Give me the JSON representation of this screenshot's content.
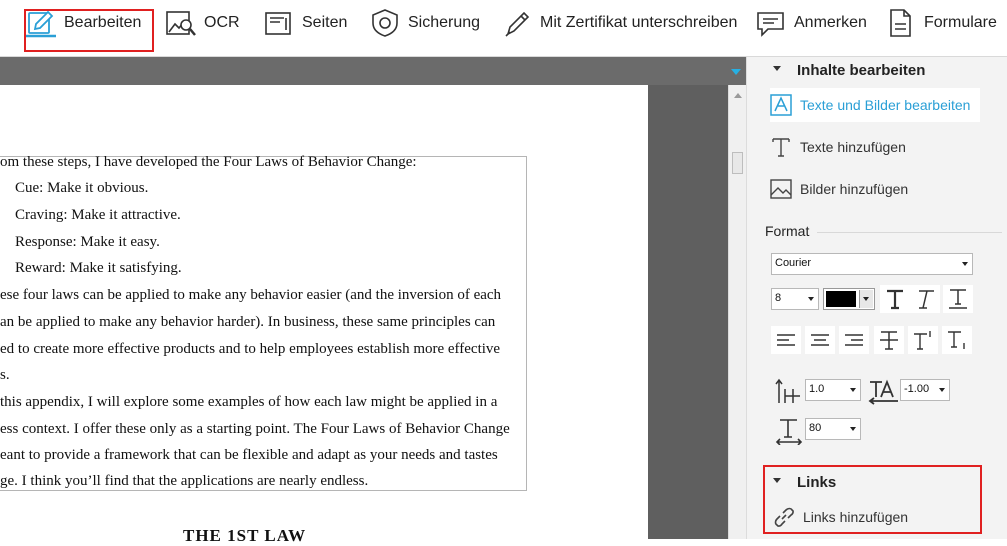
{
  "toolbar": {
    "items": [
      {
        "label": "Bearbeiten",
        "icon": "edit-pen-icon"
      },
      {
        "label": "OCR",
        "icon": "ocr-scan-icon"
      },
      {
        "label": "Seiten",
        "icon": "pages-icon"
      },
      {
        "label": "Sicherung",
        "icon": "shield-icon"
      },
      {
        "label": "Mit Zertifikat unterschreiben",
        "icon": "certificate-pen-icon"
      },
      {
        "label": "Anmerken",
        "icon": "comment-icon"
      },
      {
        "label": "Formulare",
        "icon": "form-icon"
      }
    ]
  },
  "document": {
    "lines": [
      "om these steps, I have developed the Four Laws of Behavior Change:",
      "Cue: Make it obvious.",
      "Craving: Make it attractive.",
      "Response: Make it easy.",
      "Reward: Make it satisfying.",
      "ese four laws can be applied to make any behavior easier (and the inversion of each",
      "an be applied to make any behavior harder). In business, these same principles can",
      "ed to create more effective products and to help employees establish more effective",
      "s.",
      " this appendix, I will explore some examples of how each law might be applied in a",
      "ess context. I offer these only as a starting point. The Four Laws of Behavior Change",
      "eant to provide a framework that can be flexible and adapt as your needs and tastes",
      "ge. I think you’ll find that the applications are nearly endless."
    ],
    "heading_fragment": "THE 1ST LAW"
  },
  "sidebar": {
    "content_section": {
      "title": "Inhalte bearbeiten",
      "items": [
        {
          "label": "Texte und Bilder bearbeiten",
          "icon": "text-image-edit-icon",
          "active": true
        },
        {
          "label": "Texte hinzufügen",
          "icon": "text-add-icon",
          "active": false
        },
        {
          "label": "Bilder hinzufügen",
          "icon": "image-add-icon",
          "active": false
        }
      ]
    },
    "format": {
      "label": "Format",
      "font": "Courier",
      "size": "8",
      "color": "#000000",
      "line_spacing": "1.0",
      "char_spacing": "-1.00",
      "scale": "80"
    },
    "links_section": {
      "title": "Links",
      "item": {
        "label": "Links hinzufügen",
        "icon": "link-icon"
      }
    }
  },
  "colors": {
    "accent": "#2a9fd6",
    "highlight": "#e02020",
    "document_background": "#5f5f5f"
  }
}
